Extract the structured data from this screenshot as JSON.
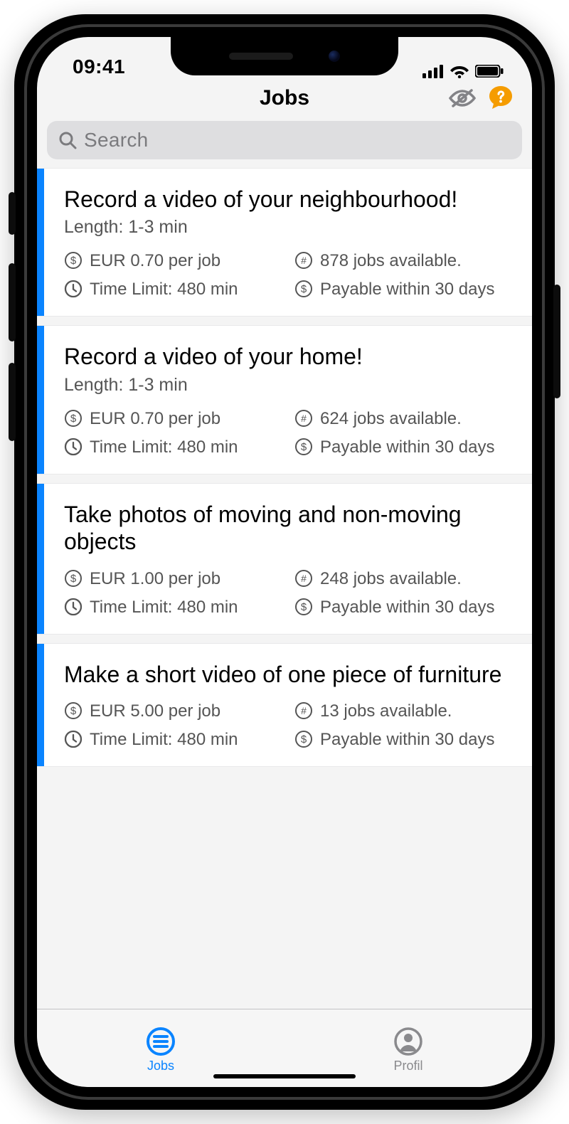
{
  "statusbar": {
    "time": "09:41"
  },
  "header": {
    "title": "Jobs"
  },
  "search": {
    "placeholder": "Search"
  },
  "jobs": [
    {
      "title": "Record a video of your neighbourhood!",
      "subtitle": "Length: 1-3 min",
      "price": "EUR 0.70 per job",
      "time": "Time Limit: 480 min",
      "count": "878 jobs available.",
      "payable": "Payable within 30 days"
    },
    {
      "title": "Record a video of your home!",
      "subtitle": "Length: 1-3 min",
      "price": "EUR 0.70 per job",
      "time": "Time Limit: 480 min",
      "count": "624 jobs available.",
      "payable": "Payable within 30 days"
    },
    {
      "title": "Take photos of moving and non-moving objects",
      "subtitle": "",
      "price": "EUR 1.00 per job",
      "time": "Time Limit: 480 min",
      "count": "248 jobs available.",
      "payable": "Payable within 30 days"
    },
    {
      "title": "Make a short video of one piece of furniture",
      "subtitle": "",
      "price": "EUR 5.00 per job",
      "time": "Time Limit: 480 min",
      "count": "13 jobs available.",
      "payable": "Payable within 30 days"
    }
  ],
  "tabs": {
    "jobs": "Jobs",
    "profile": "Profil"
  },
  "colors": {
    "accent": "#0a84ff",
    "help": "#f59c00"
  }
}
